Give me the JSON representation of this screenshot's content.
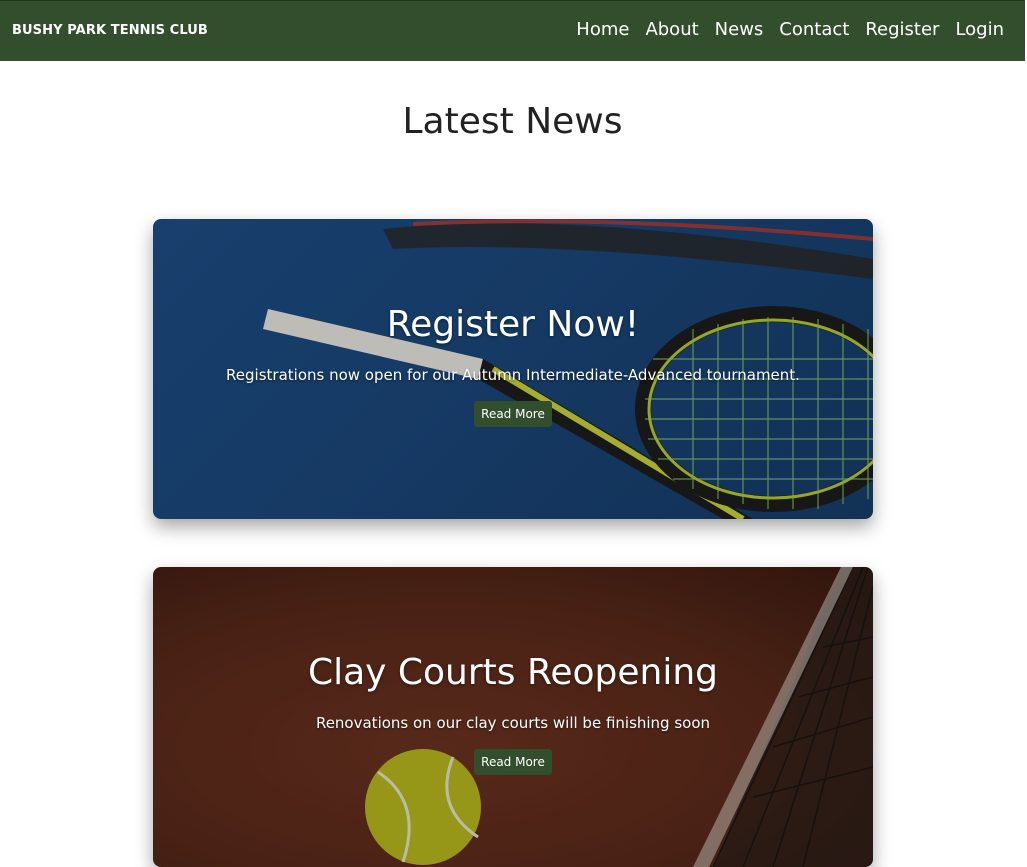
{
  "header": {
    "brand": "BUSHY PARK TENNIS CLUB",
    "nav": [
      "Home",
      "About",
      "News",
      "Contact",
      "Register",
      "Login"
    ]
  },
  "main": {
    "title": "Latest News",
    "cards": [
      {
        "title": "Register Now!",
        "text": "Registrations now open for our Autumn Intermediate-Advanced tournament.",
        "button": "Read More",
        "image": "tennis-rackets-on-blue-court"
      },
      {
        "title": "Clay Courts Reopening",
        "text": "Renovations on our clay courts will be finishing soon",
        "button": "Read More",
        "image": "tennis-ball-by-net-on-clay-court"
      }
    ]
  },
  "colors": {
    "nav_bg": "#324e2c",
    "button_bg": "#324e2c",
    "title_text": "#222222"
  }
}
